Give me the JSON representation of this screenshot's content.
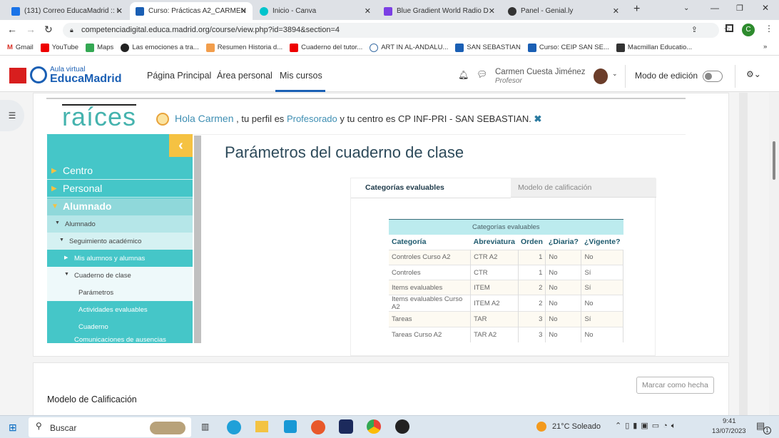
{
  "browser": {
    "tabs": [
      {
        "label": "(131) Correo EducaMadrid :: I",
        "icon": "mail-icon",
        "color": "#1a73e8"
      },
      {
        "label": "Curso: Prácticas A2_CARMEN",
        "icon": "graduation-cap-icon",
        "color": "#1a5fb4",
        "active": true
      },
      {
        "label": "Inicio - Canva",
        "icon": "canva-icon",
        "color": "#00c4cc"
      },
      {
        "label": "Blue Gradient World Radio D",
        "icon": "shield-icon",
        "color": "#7b3fe4"
      },
      {
        "label": "Panel - Genial.ly",
        "icon": "genially-icon",
        "color": "#333"
      }
    ],
    "url": "competenciadigital.educa.madrid.org/course/view.php?id=3894&section=4",
    "profile_initial": "C",
    "bookmarks": [
      "Gmail",
      "YouTube",
      "Maps",
      "Las emociones a tra...",
      "Resumen Historia d...",
      "Cuaderno del tutor...",
      "ART IN AL-ANDALU...",
      "SAN SEBASTIAN",
      "Curso: CEIP SAN SE...",
      "Macmillan Educatio..."
    ]
  },
  "site": {
    "logo_top": "Aula virtual",
    "logo_main": "EducaMadrid",
    "nav": [
      "Página Principal",
      "Área personal",
      "Mis cursos"
    ],
    "user_name": "Carmen Cuesta Jiménez",
    "user_role": "Profesor",
    "edit_mode_label": "Modo de edición"
  },
  "raices": {
    "logo": "raíces",
    "greeting_hello": "Hola Carmen",
    "greeting_mid": ", tu perfil es",
    "profile": "Profesorado",
    "greeting_end": "y tu centro es CP INF-PRI - SAN SEBASTIAN.",
    "menu": {
      "top": [
        "Centro",
        "Personal",
        "Alumnado"
      ],
      "sub": [
        "Alumnado",
        "Seguimiento académico",
        "Mis alumnos y alumnas",
        "Cuaderno de clase",
        "Parámetros",
        "Actividades evaluables",
        "Cuaderno",
        "Comunicaciones de ausencias"
      ]
    },
    "title": "Parámetros del cuaderno de clase",
    "tabs": [
      "Categorías evaluables",
      "Modelo de calificación"
    ],
    "table": {
      "caption": "Categorías evaluables",
      "headers": [
        "Categoría",
        "Abreviatura",
        "Orden",
        "¿Diaria?",
        "¿Vigente?"
      ],
      "rows": [
        [
          "Controles Curso A2",
          "CTR A2",
          "1",
          "No",
          "No"
        ],
        [
          "Controles",
          "CTR",
          "1",
          "No",
          "Sí"
        ],
        [
          "Items evaluables",
          "ITEM",
          "2",
          "No",
          "Sí"
        ],
        [
          "Items evaluables Curso A2",
          "ITEM A2",
          "2",
          "No",
          "No"
        ],
        [
          "Tareas",
          "TAR",
          "3",
          "No",
          "Sí"
        ],
        [
          "Tareas Curso A2",
          "TAR A2",
          "3",
          "No",
          "No"
        ]
      ]
    }
  },
  "section": {
    "title": "Modelo de Calificación",
    "mark_done": "Marcar como hecha"
  },
  "taskbar": {
    "search": "Buscar",
    "weather": "21°C  Soleado",
    "time": "9:41",
    "date": "13/07/2023",
    "notifications": "1"
  }
}
